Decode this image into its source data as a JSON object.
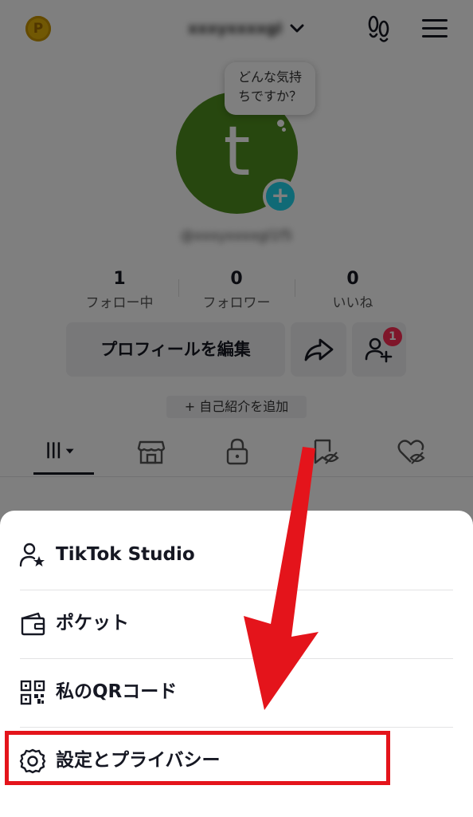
{
  "header": {
    "coin_label": "P",
    "username": "xxxyxxxxgl",
    "chevron_icon": "chevron-down-icon",
    "footprint_icon": "footprint-icon",
    "menu_icon": "hamburger-menu-icon"
  },
  "profile": {
    "avatar_letter": "t",
    "avatar_color": "#4f8f1e",
    "status_bubble": "どんな気持ちですか？",
    "handle": "@xxxyxxxxgl1f5"
  },
  "stats": [
    {
      "value": "1",
      "label": "フォロー中"
    },
    {
      "value": "0",
      "label": "フォロワー"
    },
    {
      "value": "0",
      "label": "いいね"
    }
  ],
  "actions": {
    "edit_profile": "プロフィールを編集",
    "share_icon": "share-icon",
    "add_friend_icon": "add-friend-icon",
    "add_friend_badge": "1",
    "add_bio": "+ 自己紹介を追加"
  },
  "tabs": [
    "videos-grid-icon",
    "shop-icon",
    "lock-icon",
    "hidden-repost-icon",
    "liked-hidden-icon"
  ],
  "sheet": {
    "items": [
      {
        "label": "TikTok Studio",
        "icon": "person-star-icon"
      },
      {
        "label": "ポケット",
        "icon": "wallet-icon"
      },
      {
        "label": "私のQRコード",
        "icon": "qr-code-icon"
      },
      {
        "label": "設定とプライバシー",
        "icon": "gear-icon"
      }
    ]
  },
  "colors": {
    "accent_red": "#fe2c55",
    "annotation_red": "#e4141b",
    "plus_badge": "#20d5ec"
  }
}
